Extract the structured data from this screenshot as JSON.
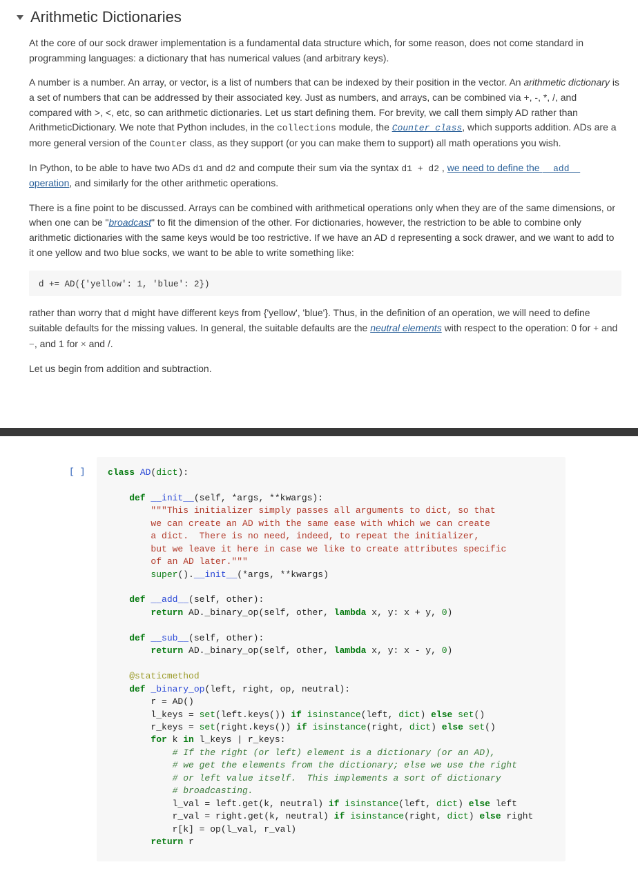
{
  "title": "Arithmetic Dictionaries",
  "p1": "At the core of our sock drawer implementation is a fundamental data structure which, for some reason, does not come standard in programming languages: a dictionary that has numerical values (and arbitrary keys).",
  "p2a": "A number is a number. An array, or vector, is a list of numbers that can be indexed by their position in the vector. An ",
  "p2_ital": "arithmetic dictionary",
  "p2b": " is a set of numbers that can be addressed by their associated key. Just as numbers, and arrays, can be combined via +, -, *, /, and compared with >, <, etc, so can arithmetic dictionaries. Let us start defining them. For brevity, we call them simply AD rather than ArithmeticDictionary. We note that Python includes, in the ",
  "p2_m1": "collections",
  "p2c": " module, the ",
  "p2_lnk1": "Counter class",
  "p2d": ", which supports addition. ADs are a more general version of the ",
  "p2_m2": "Counter",
  "p2e": " class, as they support (or you can make them to support) all math operations you wish.",
  "p3a": "In Python, to be able to have two ADs ",
  "p3_m1": "d1",
  "p3b": " and ",
  "p3_m2": "d2",
  "p3c": " and compute their sum via the syntax ",
  "p3_m3": "d1 + d2",
  "p3d": " , ",
  "p3_lnk_a": "we need to define the ",
  "p3_lnk_m": "__add__",
  "p3_lnk_b": " operation",
  "p3e": ", and similarly for the other arithmetic operations.",
  "p4a": "There is a fine point to be discussed. Arrays can be combined with arithmetical operations only when they are of the same dimensions, or when one can be \"",
  "p4_lnk": "broadcast",
  "p4b": "\" to fit the dimension of the other. For dictionaries, however, the restriction to be able to combine only arithmetic dictionaries with the same keys would be too restrictive. If we have an AD ",
  "p4_m1": "d",
  "p4c": " representing a sock drawer, and we want to add to it one yellow and two blue socks, we want to be able to write something like:",
  "codebox": "d += AD({'yellow': 1, 'blue': 2})",
  "p5a": "rather than worry that ",
  "p5_m1": "d",
  "p5b": " might have different keys from {'yellow', 'blue'}. Thus, in the definition of an operation, we will need to define suitable defaults for the missing values. In general, the suitable defaults are the ",
  "p5_lnk": "neutral elements",
  "p5c": " with respect to the operation: 0 for ",
  "p5_op1": "+",
  "p5d": " and ",
  "p5_op2": "−",
  "p5e": ", and 1 for ",
  "p5_op3": "×",
  "p5f": " and /.",
  "p6": "Let us begin from addition and subtraction.",
  "prompt": "[ ]",
  "code": {
    "l1a": "class ",
    "l1b": "AD",
    "l1c": "(",
    "l1d": "dict",
    "l1e": "):",
    "l3a": "    def ",
    "l3b": "__init__",
    "l3c": "(self, *args, **kwargs):",
    "l4": "        \"\"\"This initializer simply passes all arguments to dict, so that",
    "l5": "        we can create an AD with the same ease with which we can create",
    "l6": "        a dict.  There is no need, indeed, to repeat the initializer,",
    "l7": "        but we leave it here in case we like to create attributes specific",
    "l8": "        of an AD later.\"\"\"",
    "l9a": "        ",
    "l9b": "super",
    "l9c": "().",
    "l9d": "__init__",
    "l9e": "(*args, **kwargs)",
    "l11a": "    def ",
    "l11b": "__add__",
    "l11c": "(self, other):",
    "l12a": "        return ",
    "l12b": "AD._binary_op(self, other, ",
    "l12c": "lambda",
    "l12d": " x, y: x + y, ",
    "l12e": "0",
    "l12f": ")",
    "l14a": "    def ",
    "l14b": "__sub__",
    "l14c": "(self, other):",
    "l15a": "        return ",
    "l15b": "AD._binary_op(self, other, ",
    "l15c": "lambda",
    "l15d": " x, y: x - y, ",
    "l15e": "0",
    "l15f": ")",
    "l17": "    @staticmethod",
    "l18a": "    def ",
    "l18b": "_binary_op",
    "l18c": "(left, right, op, neutral):",
    "l19": "        r = AD()",
    "l20a": "        l_keys = ",
    "l20b": "set",
    "l20c": "(left.keys()) ",
    "l20d": "if ",
    "l20e": "isinstance",
    "l20f": "(left, ",
    "l20g": "dict",
    "l20h": ") ",
    "l20i": "else ",
    "l20j": "set",
    "l20k": "()",
    "l21a": "        r_keys = ",
    "l21b": "set",
    "l21c": "(right.keys()) ",
    "l21d": "if ",
    "l21e": "isinstance",
    "l21f": "(right, ",
    "l21g": "dict",
    "l21h": ") ",
    "l21i": "else ",
    "l21j": "set",
    "l21k": "()",
    "l22a": "        for ",
    "l22b": "k ",
    "l22c": "in ",
    "l22d": "l_keys | r_keys:",
    "l23": "            # If the right (or left) element is a dictionary (or an AD),",
    "l24": "            # we get the elements from the dictionary; else we use the right",
    "l25": "            # or left value itself.  This implements a sort of dictionary",
    "l26": "            # broadcasting.",
    "l27a": "            l_val = left.get(k, neutral) ",
    "l27b": "if ",
    "l27c": "isinstance",
    "l27d": "(left, ",
    "l27e": "dict",
    "l27f": ") ",
    "l27g": "else ",
    "l27h": "left",
    "l28a": "            r_val = right.get(k, neutral) ",
    "l28b": "if ",
    "l28c": "isinstance",
    "l28d": "(right, ",
    "l28e": "dict",
    "l28f": ") ",
    "l28g": "else ",
    "l28h": "right",
    "l29": "            r[k] = op(l_val, r_val)",
    "l30a": "        return ",
    "l30b": "r"
  }
}
